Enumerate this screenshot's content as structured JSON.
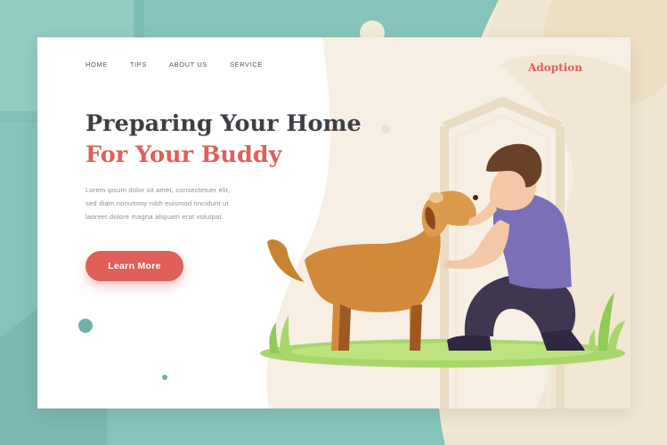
{
  "nav": {
    "items": [
      {
        "label": "HOME"
      },
      {
        "label": "TIPS"
      },
      {
        "label": "ABOUT US"
      },
      {
        "label": "SERVICE"
      }
    ],
    "adoption_label": "Adoption"
  },
  "hero": {
    "title_line1": "Preparing Your Home",
    "title_line2": "For Your Buddy",
    "body_lines": [
      "Lorem ipsum dolor sit amet, consectetuer  elit,",
      "sed diam nonummy nibh euismod tincidunt ut",
      "laoreet dolore magna aliquam erat volutpat."
    ],
    "cta_label": "Learn More"
  },
  "colors": {
    "accent": "#e05f58",
    "heading": "#3d3f44",
    "teal": "#86c4bb",
    "beige": "#f1e6d2",
    "grass": "#a9d66a",
    "shirt": "#7a70b8",
    "dog": "#d28a3a"
  }
}
